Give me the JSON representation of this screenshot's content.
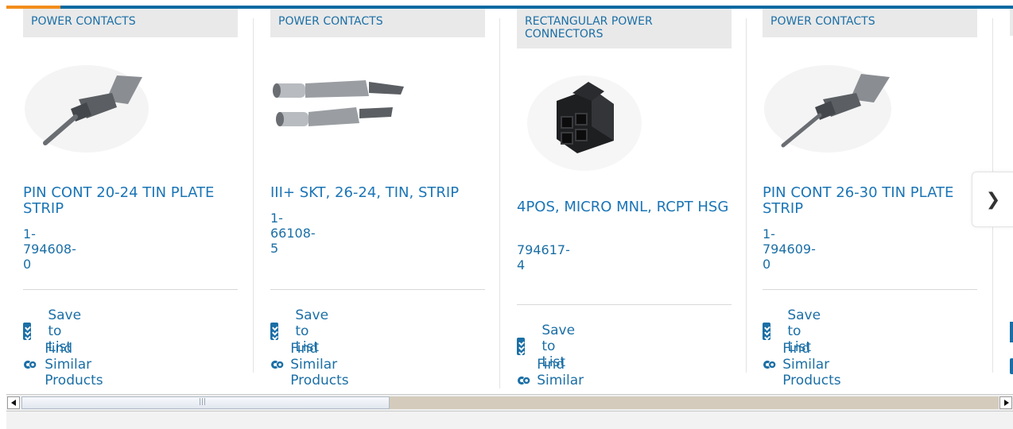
{
  "carousel": {
    "cards": [
      {
        "category": "POWER CONTACTS",
        "title": "PIN CONT 20-24 TIN PLATE STRIP",
        "part_number": "1-794608-0",
        "save_label": "Save to List",
        "similar_label": "Find Similar Products",
        "image_icon": "pin-contact-image"
      },
      {
        "category": "POWER CONTACTS",
        "title": "III+ SKT, 26-24, TIN, STRIP",
        "part_number": "1-66108-5",
        "save_label": "Save to List",
        "similar_label": "Find Similar Products",
        "image_icon": "socket-contacts-image"
      },
      {
        "category": "RECTANGULAR POWER CONNECTORS",
        "title": "4POS, MICRO MNL, RCPT HSG",
        "part_number": "794617-4",
        "save_label": "Save to List",
        "similar_label": "Find Similar Products",
        "image_icon": "connector-housing-image"
      },
      {
        "category": "POWER CONTACTS",
        "title": "PIN CONT 26-30 TIN PLATE STRIP",
        "part_number": "1-794609-0",
        "save_label": "Save to List",
        "similar_label": "Find Similar Products",
        "image_icon": "pin-contact-image"
      }
    ],
    "next_icon": "chevron-right-icon"
  },
  "colors": {
    "link": "#1b75b6",
    "tag_bg": "#e9e9e9",
    "accent": "#f28d1a",
    "topbar": "#0a6aa1"
  }
}
